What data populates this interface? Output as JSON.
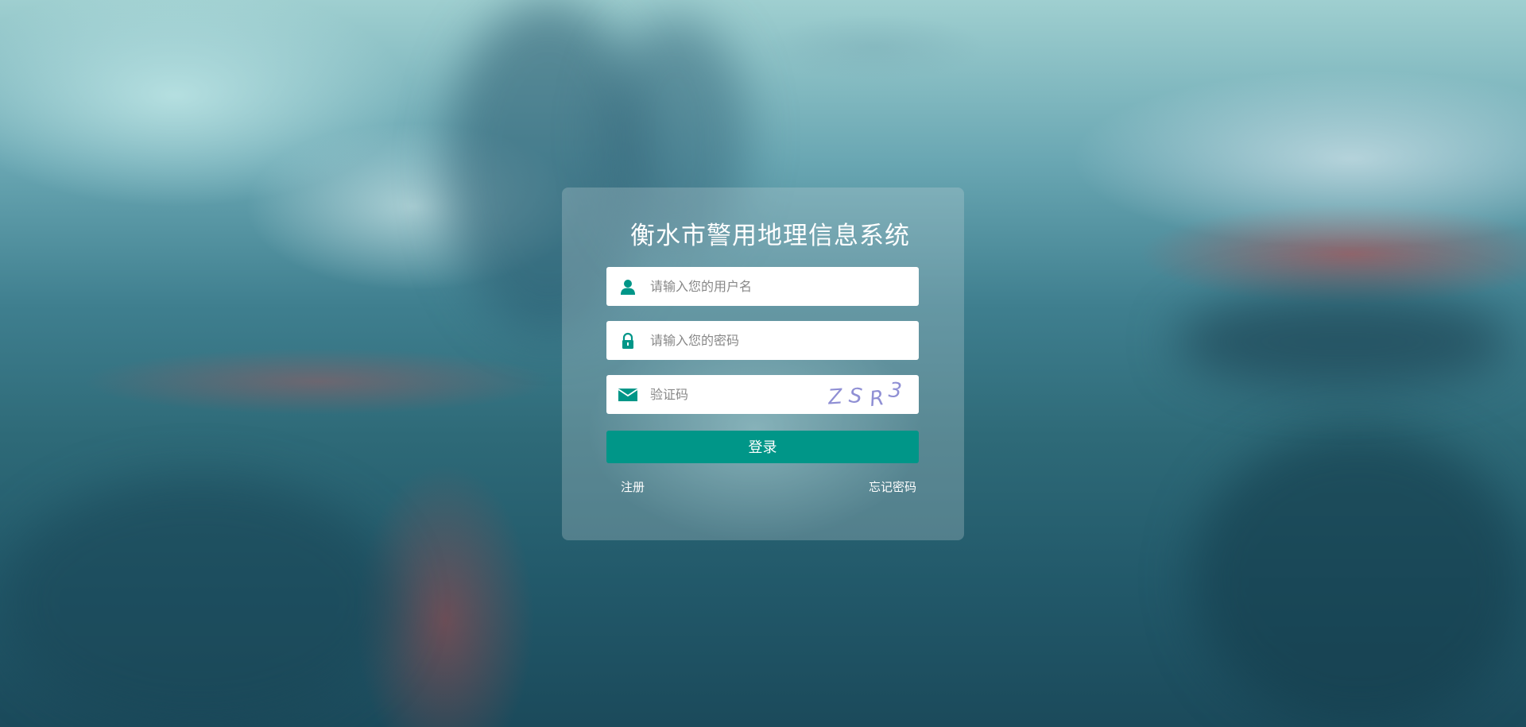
{
  "login": {
    "title": "衡水市警用地理信息系统",
    "username": {
      "placeholder": "请输入您的用户名",
      "icon": "user-icon",
      "value": ""
    },
    "password": {
      "placeholder": "请输入您的密码",
      "icon": "lock-icon",
      "value": ""
    },
    "captcha": {
      "placeholder": "验证码",
      "icon": "envelope-icon",
      "value": "",
      "image_text": [
        "Z",
        "S",
        "R",
        "3"
      ]
    },
    "submit_label": "登录",
    "register_label": "注册",
    "forgot_label": "忘记密码"
  },
  "colors": {
    "accent": "#009688",
    "icon": "#009688",
    "captcha_text": "#8f8fd4",
    "card_bg": "rgba(200,215,220,0.28)"
  }
}
